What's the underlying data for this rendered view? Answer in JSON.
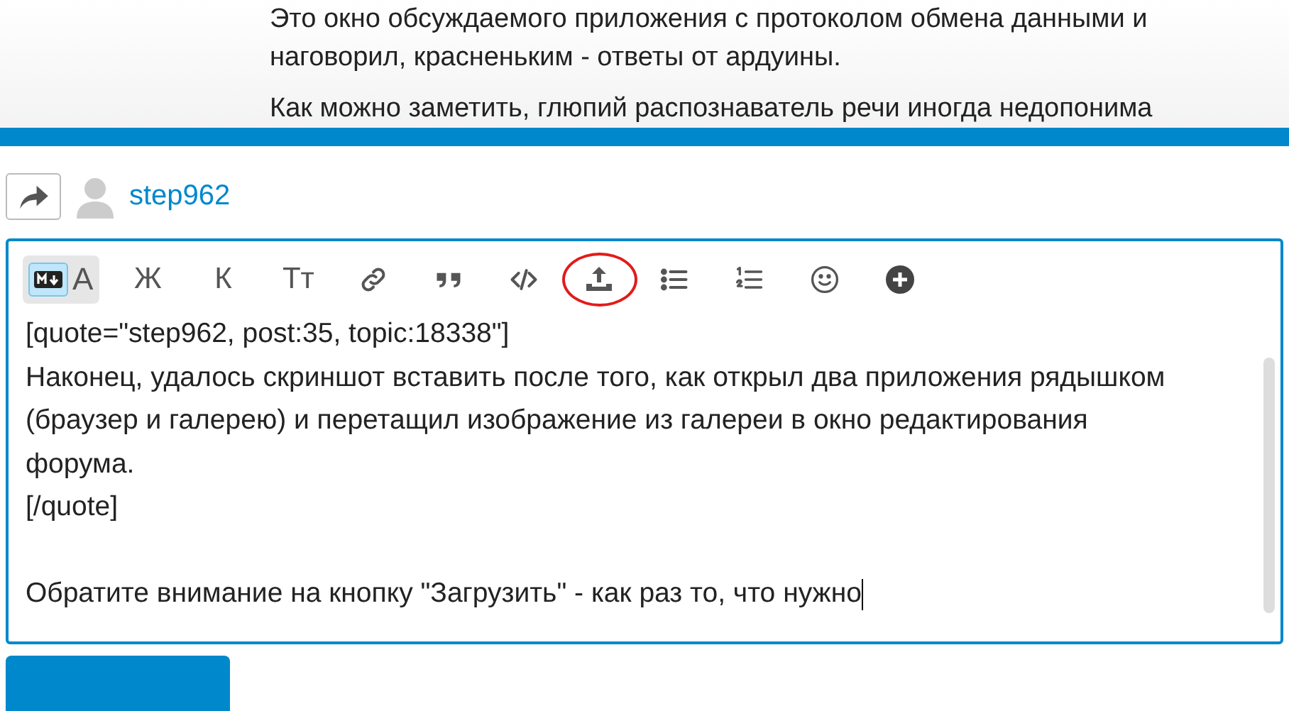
{
  "post": {
    "lines": [
      "Это окно обсуждаемого приложения с протоколом обмена данными и",
      "наговорил, красненьким - ответы от ардуины."
    ],
    "paragraph": "Как можно заметить, глюпий распознаватель речи иногда недопонима"
  },
  "reply_to": {
    "user": "step962"
  },
  "toolbar": [
    {
      "kind": "mode",
      "label": "A",
      "selected": true
    },
    {
      "kind": "text",
      "label": "Ж",
      "highlighted": false
    },
    {
      "kind": "text",
      "label": "К",
      "highlighted": false
    },
    {
      "kind": "text",
      "label": "Тт",
      "highlighted": false
    },
    {
      "kind": "link",
      "highlighted": false
    },
    {
      "kind": "quote",
      "highlighted": false
    },
    {
      "kind": "code",
      "highlighted": false
    },
    {
      "kind": "upload",
      "highlighted": true
    },
    {
      "kind": "bullets",
      "highlighted": false
    },
    {
      "kind": "numbers",
      "highlighted": false
    },
    {
      "kind": "emoji",
      "highlighted": false
    },
    {
      "kind": "plus",
      "highlighted": false
    }
  ],
  "editor": {
    "quote_lines": [
      "[quote=\"step962, post:35, topic:18338\"]",
      "Наконец, удалось скриншот вставить после того, как открыл два приложения рядышком (браузер и галерею) и перетащил изображение из галереи в окно редактирования форума.",
      "[/quote]"
    ],
    "text": "Обратите внимание на кнопку \"Загрузить\" - как раз то, что нужно"
  }
}
